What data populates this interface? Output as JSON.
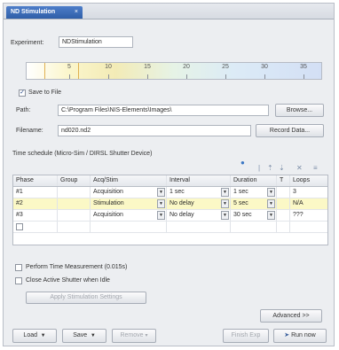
{
  "tab": {
    "title": "ND Stimulation",
    "close_glyph": "×"
  },
  "experiment": {
    "label": "Experiment:",
    "value": "NDStimulation"
  },
  "wavelength_ticks": [
    "5",
    "10",
    "15",
    "20",
    "25",
    "30",
    "35"
  ],
  "save": {
    "checkbox_label": "Save to File",
    "checked": true,
    "path_label": "Path:",
    "path_value": "C:\\Program Files\\NIS-Elements\\Images\\",
    "browse_label": "Browse...",
    "filename_label": "Filename:",
    "filename_value": "nd020.nd2",
    "record_label": "Record Data..."
  },
  "schedule": {
    "title": "Time schedule (Micro-Sim / DIRSL Shutter Device)",
    "toolbar": [
      "|",
      "⇡",
      "⇣",
      "✕",
      "≡"
    ],
    "columns": [
      "Phase",
      "Group",
      "Acq/Stim",
      "Interval",
      "Duration",
      "T",
      "Loops"
    ],
    "rows": [
      {
        "phase": "#1",
        "group": "",
        "acq": "Acquisition",
        "interval": "1 sec",
        "duration": "1 sec",
        "loops": "3"
      },
      {
        "phase": "#2",
        "group": "",
        "acq": "Stimulation",
        "interval": "No delay",
        "duration": "5 sec",
        "loops": "N/A"
      },
      {
        "phase": "#3",
        "group": "",
        "acq": "Acquisition",
        "interval": "No delay",
        "duration": "30 sec",
        "loops": "???"
      }
    ]
  },
  "options": {
    "perform_label": "Perform Time Measurement (0.015s)",
    "close_label": "Close Active Shutter when Idle",
    "apply_label": "Apply Stimulation Settings"
  },
  "advanced_label": "Advanced >>",
  "bottom": {
    "load_label": "Load",
    "save_label": "Save",
    "remove_label": "Remove",
    "finish_label": "Finish Exp",
    "run_label": "Run now"
  }
}
